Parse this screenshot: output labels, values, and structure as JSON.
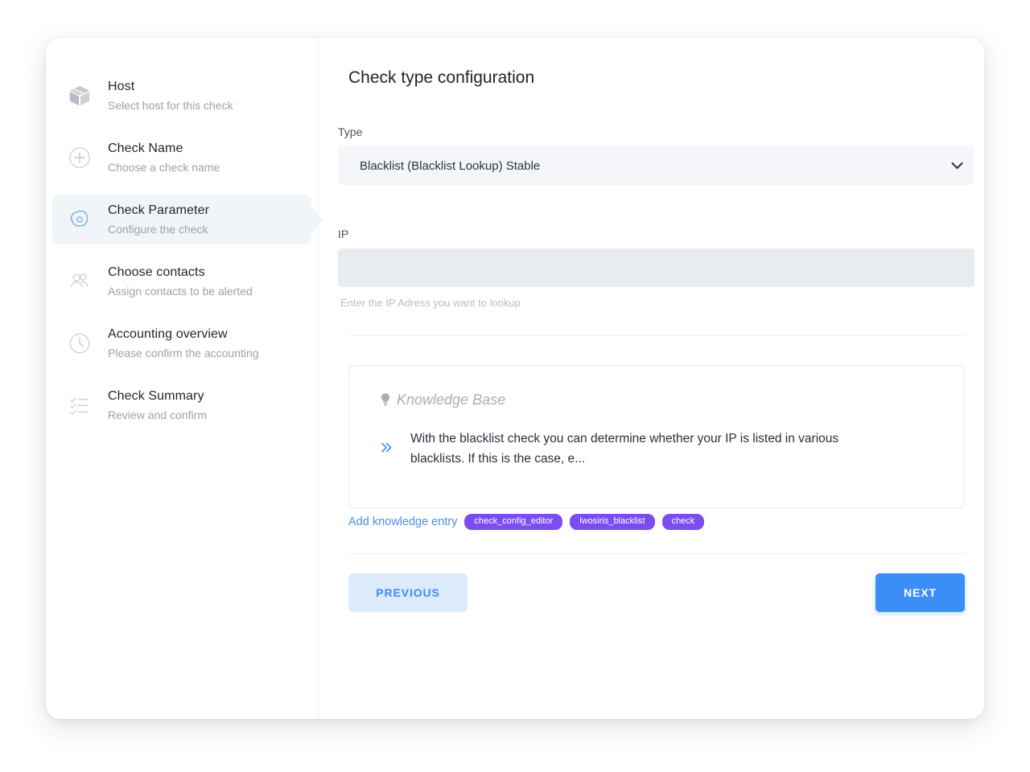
{
  "sidebar": {
    "items": [
      {
        "icon": "package-icon",
        "title": "Host",
        "subtitle": "Select host for this check",
        "active": false
      },
      {
        "icon": "plus-circle-icon",
        "title": "Check Name",
        "subtitle": "Choose a check name",
        "active": false
      },
      {
        "icon": "gear-icon",
        "title": "Check Parameter",
        "subtitle": "Configure the check",
        "active": true
      },
      {
        "icon": "users-icon",
        "title": "Choose contacts",
        "subtitle": "Assign contacts to be alerted",
        "active": false
      },
      {
        "icon": "clock-icon",
        "title": "Accounting overview",
        "subtitle": "Please confirm the accounting",
        "active": false
      },
      {
        "icon": "checklist-icon",
        "title": "Check Summary",
        "subtitle": "Review and confirm",
        "active": false
      }
    ]
  },
  "main": {
    "title": "Check type configuration",
    "type_field": {
      "label": "Type",
      "value": "Blacklist (Blacklist Lookup) Stable",
      "chevron_icon": "chevron-down-icon"
    },
    "ip_field": {
      "label": "IP",
      "value": "",
      "placeholder": "",
      "helper": "Enter the IP Adress you want to lookup"
    },
    "knowledge_base": {
      "bulb_icon": "lightbulb-icon",
      "heading": "Knowledge Base",
      "chevrons_icon": "double-chevron-right-icon",
      "entry_text": "With the blacklist check you can determine whether your IP is listed in various blacklists. If this is the case, e...",
      "add_link": "Add knowledge entry",
      "tags": [
        "check_config_editor",
        "lwosiris_blacklist",
        "check"
      ]
    },
    "footer": {
      "previous_label": "PREVIOUS",
      "next_label": "NEXT"
    }
  },
  "colors": {
    "accent_blue": "#3b8ef5",
    "prev_button_bg": "#ddeafb",
    "tag_purple": "#7b4df0",
    "active_step_bg": "#f1f5f9",
    "input_bg": "#e8ebf0",
    "select_bg": "#f4f6f9"
  }
}
